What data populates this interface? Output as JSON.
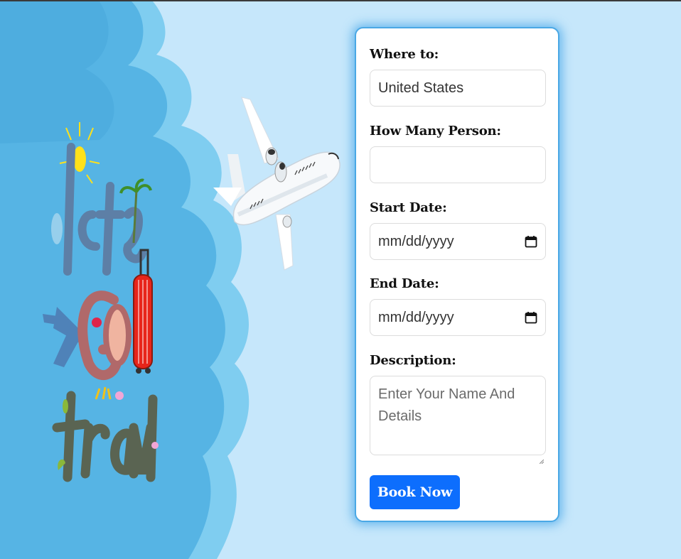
{
  "form": {
    "where_label": "Where to:",
    "where_value": "United States",
    "persons_label": "How Many Person:",
    "persons_value": "",
    "start_label": "Start Date:",
    "start_value": "mm/dd/yyyy",
    "end_label": "End Date:",
    "end_value": "mm/dd/yyyy",
    "description_label": "Description:",
    "description_placeholder": "Enter Your Name And Details",
    "book_button": "Book Now"
  },
  "hero": {
    "logo_text": "let's Go travel"
  },
  "icons": {
    "calendar": "calendar-icon",
    "airplane": "airplane-illustration"
  },
  "colors": {
    "page_background": "#c6e7fb",
    "cloud_dark": "#56b4e4",
    "cloud_light": "#7fcdf0",
    "card_border": "#4aa8e5",
    "button": "#0d6efd"
  }
}
